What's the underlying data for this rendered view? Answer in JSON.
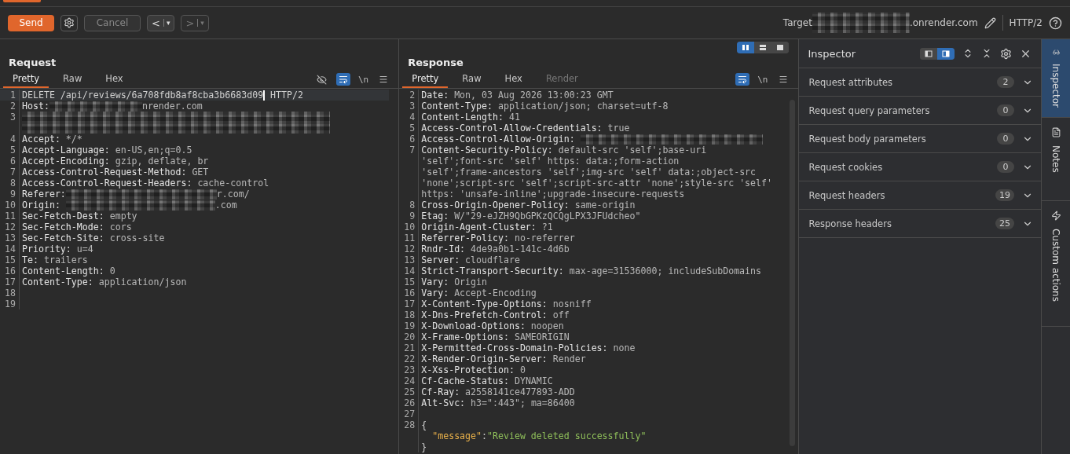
{
  "toolbar": {
    "send": "Send",
    "cancel": "Cancel",
    "cancel_disabled": true,
    "back": {
      "arrow": "<",
      "caret": "▾",
      "disabled": false
    },
    "forward": {
      "arrow": ">",
      "caret": "▾",
      "disabled": true
    },
    "target_label": "Target",
    "target_suffix": ".onrender.com",
    "protocol": "HTTP/2"
  },
  "request": {
    "title": "Request",
    "tabs": [
      {
        "label": "Pretty",
        "selected": true,
        "disabled": false
      },
      {
        "label": "Raw",
        "selected": false,
        "disabled": false
      },
      {
        "label": "Hex",
        "selected": false,
        "disabled": false
      }
    ],
    "newline": "\\n",
    "wrap_on": true,
    "hide_on": false,
    "lines": [
      {
        "no": "1",
        "kind": "request_line",
        "text": "DELETE /api/reviews/6a708fdb8af8cba3b6683d09",
        "after_caret": " HTTP/2",
        "current": true
      },
      {
        "no": "2",
        "kind": "header",
        "name": "Host:",
        "redacted": true,
        "value": "nrender.com"
      },
      {
        "no": "3",
        "kind": "redacted"
      },
      {
        "no": "4",
        "kind": "header",
        "name": "Accept:",
        "value": " */*"
      },
      {
        "no": "5",
        "kind": "header",
        "name": "Accept-Language:",
        "value": " en-US,en;q=0.5"
      },
      {
        "no": "6",
        "kind": "header",
        "name": "Accept-Encoding:",
        "value": " gzip, deflate, br"
      },
      {
        "no": "7",
        "kind": "header",
        "name": "Access-Control-Request-Method:",
        "value": " GET"
      },
      {
        "no": "8",
        "kind": "header",
        "name": "Access-Control-Request-Headers:",
        "value": " cache-control"
      },
      {
        "no": "9",
        "kind": "header",
        "name": "Referer:",
        "redacted": true,
        "value": "r.com/"
      },
      {
        "no": "10",
        "kind": "header",
        "name": "Origin: ",
        "redacted": true,
        "value": ".com"
      },
      {
        "no": "11",
        "kind": "header",
        "name": "Sec-Fetch-Dest:",
        "value": " empty"
      },
      {
        "no": "12",
        "kind": "header",
        "name": "Sec-Fetch-Mode:",
        "value": " cors"
      },
      {
        "no": "13",
        "kind": "header",
        "name": "Sec-Fetch-Site:",
        "value": " cross-site"
      },
      {
        "no": "14",
        "kind": "header",
        "name": "Priority:",
        "value": " u=4"
      },
      {
        "no": "15",
        "kind": "header",
        "name": "Te:",
        "value": " trailers"
      },
      {
        "no": "16",
        "kind": "header",
        "name": "Content-Length:",
        "value": " 0"
      },
      {
        "no": "17",
        "kind": "header",
        "name": "Content-Type:",
        "value": " application/json"
      },
      {
        "no": "18",
        "kind": "blank"
      },
      {
        "no": "19",
        "kind": "blank"
      }
    ]
  },
  "response": {
    "title": "Response",
    "layout": [
      {
        "kind": "columns",
        "selected": true
      },
      {
        "kind": "rows",
        "selected": false
      },
      {
        "kind": "single",
        "selected": false
      }
    ],
    "tabs": [
      {
        "label": "Pretty",
        "selected": true,
        "disabled": false
      },
      {
        "label": "Raw",
        "selected": false,
        "disabled": false
      },
      {
        "label": "Hex",
        "selected": false,
        "disabled": false
      },
      {
        "label": "Render",
        "selected": false,
        "disabled": true
      }
    ],
    "newline": "\\n",
    "wrap_on": true,
    "lines": [
      {
        "no": "2",
        "kind": "header",
        "name": "Date:",
        "value": " Mon, 03 Aug 2026 13:00:23 GMT"
      },
      {
        "no": "3",
        "kind": "header",
        "name": "Content-Type:",
        "value": " application/json; charset=utf-8"
      },
      {
        "no": "4",
        "kind": "header",
        "name": "Content-Length:",
        "value": " 41"
      },
      {
        "no": "5",
        "kind": "header",
        "name": "Access-Control-Allow-Credentials:",
        "value": " true"
      },
      {
        "no": "6",
        "kind": "header",
        "name": "Access-Control-Allow-Origin: ",
        "redacted": true
      },
      {
        "no": "7",
        "kind": "header",
        "name": "Content-Security-Policy:",
        "value": " default-src 'self';base-uri 'self';font-src 'self' https: data:;form-action 'self';frame-ancestors 'self';img-src 'self' data:;object-src 'none';script-src 'self';script-src-attr 'none';style-src 'self' https: 'unsafe-inline';upgrade-insecure-requests"
      },
      {
        "no": "8",
        "kind": "header",
        "name": "Cross-Origin-Opener-Policy:",
        "value": " same-origin"
      },
      {
        "no": "9",
        "kind": "header",
        "name": "Etag:",
        "value": " W/\"29-eJZH9QbGPKzQCQgLPX3JFUdcheo\""
      },
      {
        "no": "10",
        "kind": "header",
        "name": "Origin-Agent-Cluster:",
        "value": " ?1"
      },
      {
        "no": "11",
        "kind": "header",
        "name": "Referrer-Policy:",
        "value": " no-referrer"
      },
      {
        "no": "12",
        "kind": "header",
        "name": "Rndr-Id:",
        "value": " 4de9a0b1-141c-4d6b"
      },
      {
        "no": "13",
        "kind": "header",
        "name": "Server:",
        "value": " cloudflare"
      },
      {
        "no": "14",
        "kind": "header",
        "name": "Strict-Transport-Security:",
        "value": " max-age=31536000; includeSubDomains"
      },
      {
        "no": "15",
        "kind": "header",
        "name": "Vary:",
        "value": " Origin"
      },
      {
        "no": "16",
        "kind": "header",
        "name": "Vary:",
        "value": " Accept-Encoding"
      },
      {
        "no": "17",
        "kind": "header",
        "name": "X-Content-Type-Options:",
        "value": " nosniff"
      },
      {
        "no": "18",
        "kind": "header",
        "name": "X-Dns-Prefetch-Control:",
        "value": " off"
      },
      {
        "no": "19",
        "kind": "header",
        "name": "X-Download-Options:",
        "value": " noopen"
      },
      {
        "no": "20",
        "kind": "header",
        "name": "X-Frame-Options:",
        "value": " SAMEORIGIN"
      },
      {
        "no": "21",
        "kind": "header",
        "name": "X-Permitted-Cross-Domain-Policies:",
        "value": " none"
      },
      {
        "no": "22",
        "kind": "header",
        "name": "X-Render-Origin-Server:",
        "value": " Render"
      },
      {
        "no": "23",
        "kind": "header",
        "name": "X-Xss-Protection:",
        "value": " 0"
      },
      {
        "no": "24",
        "kind": "header",
        "name": "Cf-Cache-Status:",
        "value": " DYNAMIC"
      },
      {
        "no": "25",
        "kind": "header",
        "name": "Cf-Ray:",
        "value": " a2558141ce477893-ADD"
      },
      {
        "no": "26",
        "kind": "header",
        "name": "Alt-Svc:",
        "value": " h3=\":443\"; ma=86400"
      },
      {
        "no": "27",
        "kind": "blank"
      },
      {
        "no": "28",
        "kind": "brace",
        "text": "{"
      },
      {
        "kind": "json_pair",
        "key": "\"message\"",
        "sep": ":",
        "value": "\"Review deleted successfully\""
      },
      {
        "kind": "brace",
        "text": "}"
      }
    ]
  },
  "inspector": {
    "title": "Inspector",
    "layout": [
      {
        "kind": "left",
        "selected": false
      },
      {
        "kind": "right",
        "selected": true
      }
    ],
    "sections": [
      {
        "label": "Request attributes",
        "count": "2",
        "expanded": false
      },
      {
        "label": "Request query parameters",
        "count": "0",
        "expanded": false
      },
      {
        "label": "Request body parameters",
        "count": "0",
        "expanded": false
      },
      {
        "label": "Request cookies",
        "count": "0",
        "expanded": false
      },
      {
        "label": "Request headers",
        "count": "19",
        "expanded": false
      },
      {
        "label": "Response headers",
        "count": "25",
        "expanded": false
      }
    ]
  },
  "side_tabs": [
    {
      "kind": "inspector",
      "label": "Inspector",
      "selected": true
    },
    {
      "kind": "notes",
      "label": "Notes",
      "selected": false
    },
    {
      "kind": "actions",
      "label": "Custom actions",
      "selected": false
    }
  ]
}
